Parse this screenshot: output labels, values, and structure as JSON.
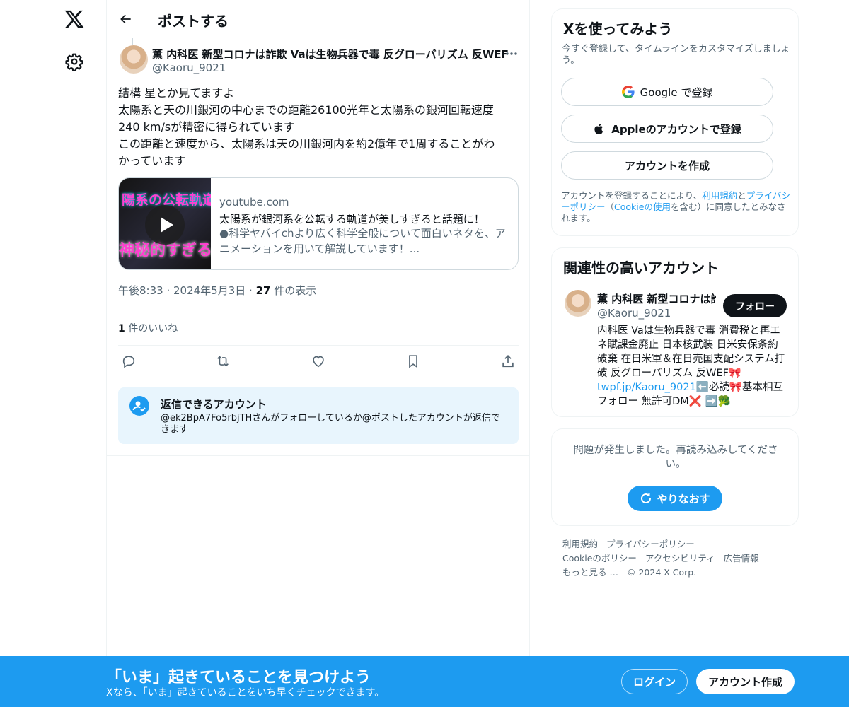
{
  "colors": {
    "accent": "#1d9bf0",
    "text": "#0f1419",
    "muted": "#536471",
    "border": "#eff3f4"
  },
  "nav": {
    "logo_icon": "x-logo-icon",
    "settings_icon": "gear-icon"
  },
  "header": {
    "title": "ポストする",
    "back_icon": "arrow-left-icon"
  },
  "post": {
    "author_name": "薫 内科医 新型コロナは詐欺 Vaは生物兵器で毒 反グローバリズム 反WEF",
    "author_handle": "@Kaoru_9021",
    "text_lines": [
      "結構 星とか見てますよ",
      "太陽系と天の川銀河の中心までの距離26100光年と太陽系の銀河回転速度",
      "240 km/sが精密に得られています",
      "この距離と速度から、太陽系は天の川銀河内を約2億年で1周することがわ",
      "かっています"
    ],
    "card": {
      "thumb_text_top": "陽系の公転軌道",
      "thumb_text_bottom": "神秘的すぎる",
      "domain": "youtube.com",
      "title": "太陽系が銀河系を公転する軌道が美しすぎると話題に！",
      "description": "●科学ヤバイchより広く科学全般について面白いネタを、アニメーションを用いて解説しています！..."
    },
    "time": "午後8:33",
    "date": "2024年5月3日",
    "views_count": "27",
    "views_label": " 件の表示",
    "likes_count": "1",
    "likes_label": " 件のいいね",
    "reply_restriction": {
      "title": "返信できるアカウント",
      "text": "@ek2BpA7Fo5rbjTHさんがフォローしているか@ポストしたアカウントが返信できます"
    }
  },
  "signup": {
    "title": "Xを使ってみよう",
    "subtitle": "今すぐ登録して、タイムラインをカスタマイズしましょう。",
    "google_label": "Google で登録",
    "apple_label": "Appleのアカウントで登録",
    "create_label": "アカウントを作成",
    "legal_prefix": "アカウントを登録することにより、",
    "legal_terms": "利用規約",
    "legal_and": "と",
    "legal_privacy": "プライバシーポリシー",
    "legal_open": "（",
    "legal_cookie": "Cookieの使用",
    "legal_suffix": "を含む）に同意したとみなされます。"
  },
  "related": {
    "title": "関連性の高いアカウント",
    "name": "薫 内科医 新型コロナは詐欺 Vaは生物兵器で毒",
    "handle": "@Kaoru_9021",
    "follow_label": "フォロー",
    "bio_prefix": "内科医 Vaは生物兵器で毒 消費税と再エネ賦課金廃止 日本核武装 日米安保条約破棄 在日米軍＆在日売国支配システム打破 反グローバリズム 反WEF🎀 ",
    "bio_link": "twpf.jp/Kaoru_9021",
    "bio_suffix": "⬅️必読🎀基本相互フォロー 無許可DM❌ ➡️🥦"
  },
  "error_panel": {
    "text": "問題が発生しました。再読み込みしてください。",
    "retry_label": "やりなおす"
  },
  "footer": {
    "links": [
      "利用規約",
      "プライバシーポリシー",
      "Cookieのポリシー",
      "アクセシビリティ",
      "広告情報",
      "もっと見る …",
      "© 2024 X Corp."
    ]
  },
  "bottom_bar": {
    "title": "「いま」起きていることを見つけよう",
    "subtitle": "Xなら、「いま」起きていることをいち早くチェックできます。",
    "login_label": "ログイン",
    "create_label": "アカウント作成"
  }
}
